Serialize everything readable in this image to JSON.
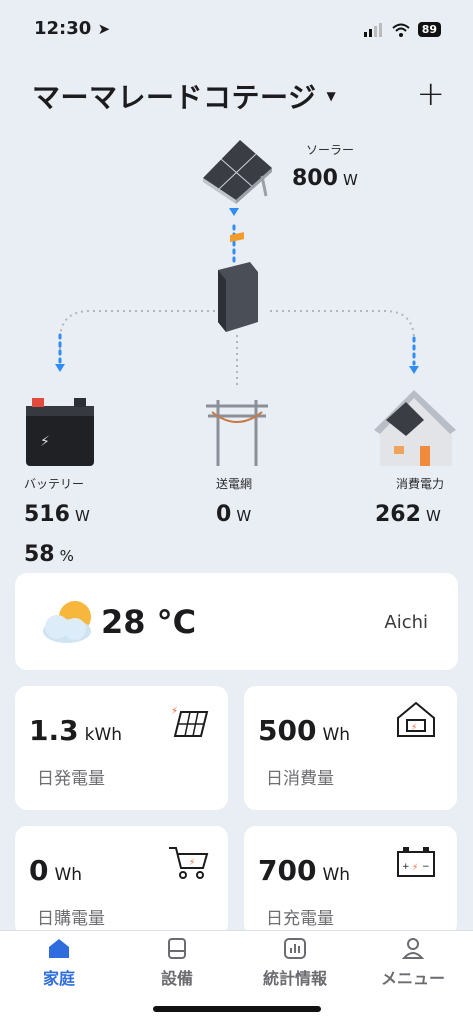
{
  "status_bar": {
    "time": "12:30",
    "battery": "89"
  },
  "header": {
    "title": "マーマレードコテージ",
    "add": "+"
  },
  "flow": {
    "solar": {
      "label": "ソーラー",
      "value": "800",
      "unit": "W"
    },
    "battery": {
      "label": "バッテリー",
      "value": "516",
      "unit": "W",
      "soc": "58",
      "soc_unit": "%"
    },
    "grid": {
      "label": "送電網",
      "value": "0",
      "unit": "W"
    },
    "consumption": {
      "label": "消費電力",
      "value": "262",
      "unit": "W"
    }
  },
  "weather": {
    "temperature": "28 °C",
    "location": "Aichi",
    "icon": "partly-cloudy-icon"
  },
  "stats": [
    {
      "value": "1.3",
      "unit": "kWh",
      "label": "日発電量",
      "icon": "solar-panel-icon"
    },
    {
      "value": "500",
      "unit": "Wh",
      "label": "日消費量",
      "icon": "house-power-icon"
    },
    {
      "value": "0",
      "unit": "Wh",
      "label": "日購電量",
      "icon": "cart-power-icon"
    },
    {
      "value": "700",
      "unit": "Wh",
      "label": "日充電量",
      "icon": "battery-charge-icon"
    }
  ],
  "tabs": [
    {
      "label": "家庭",
      "icon": "home-icon",
      "active": true
    },
    {
      "label": "設備",
      "icon": "device-icon",
      "active": false
    },
    {
      "label": "統計情報",
      "icon": "chart-icon",
      "active": false
    },
    {
      "label": "メニュー",
      "icon": "user-icon",
      "active": false
    }
  ],
  "colors": {
    "accent": "#2f6dde",
    "flow_dot": "#2f8cf0",
    "background": "#e9edf4"
  }
}
